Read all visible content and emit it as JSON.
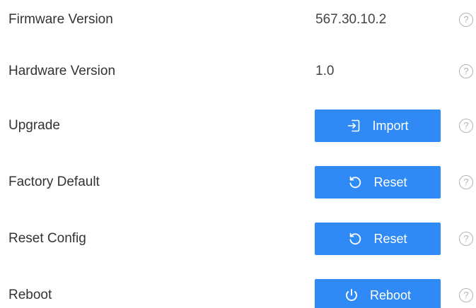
{
  "colors": {
    "primary_button": "#2f8af5",
    "button_text": "#ffffff",
    "label_text": "#333333",
    "help_icon": "#b3b3b3"
  },
  "rows": [
    {
      "label": "Firmware Version",
      "value": "567.30.10.2",
      "help_icon": "question-circle-icon"
    },
    {
      "label": "Hardware Version",
      "value": "1.0",
      "help_icon": "question-circle-icon"
    },
    {
      "label": "Upgrade",
      "button_label": "Import",
      "button_icon": "import-icon",
      "help_icon": "question-circle-icon"
    },
    {
      "label": "Factory Default",
      "button_label": "Reset",
      "button_icon": "reset-icon",
      "help_icon": "question-circle-icon"
    },
    {
      "label": "Reset Config",
      "button_label": "Reset",
      "button_icon": "reset-icon",
      "help_icon": "question-circle-icon"
    },
    {
      "label": "Reboot",
      "button_label": "Reboot",
      "button_icon": "power-icon",
      "help_icon": "question-circle-icon"
    }
  ],
  "help_glyph": "?"
}
